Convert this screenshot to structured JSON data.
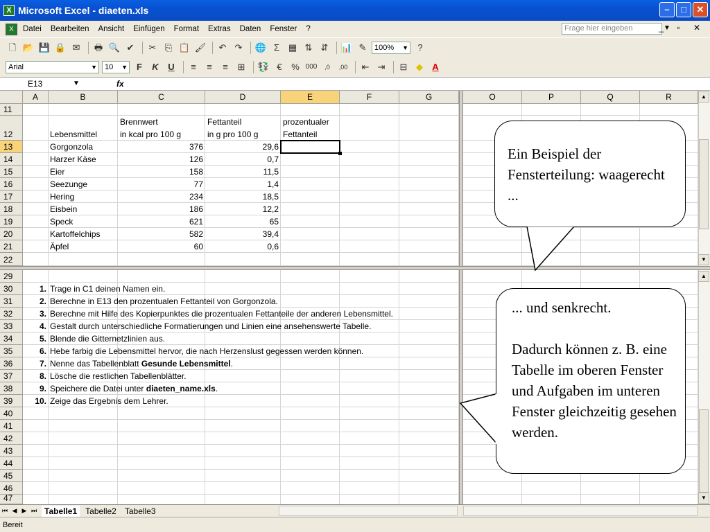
{
  "window": {
    "title": "Microsoft Excel - diaeten.xls"
  },
  "menu": {
    "items": [
      "Datei",
      "Bearbeiten",
      "Ansicht",
      "Einfügen",
      "Format",
      "Extras",
      "Daten",
      "Fenster",
      "?"
    ],
    "help_placeholder": "Frage hier eingeben"
  },
  "toolbar": {
    "zoom": "100%",
    "font": "Arial",
    "font_size": "10"
  },
  "formula_bar": {
    "name_box": "E13",
    "fx": "fx",
    "content": ""
  },
  "columns": {
    "top": [
      "A",
      "B",
      "C",
      "D",
      "E",
      "F",
      "G"
    ],
    "right": [
      "O",
      "P",
      "Q",
      "R"
    ]
  },
  "header_row": {
    "B": "Lebensmittel",
    "C1": "Brennwert",
    "C2": "in kcal pro 100 g",
    "D1": "Fettanteil",
    "D2": "in g pro 100 g",
    "E1": "prozentualer",
    "E2": "Fettanteil"
  },
  "food_rows": [
    {
      "row": "13",
      "name": "Gorgonzola",
      "kcal": "376",
      "fat": "29,6"
    },
    {
      "row": "14",
      "name": "Harzer Käse",
      "kcal": "126",
      "fat": "0,7"
    },
    {
      "row": "15",
      "name": "Eier",
      "kcal": "158",
      "fat": "11,5"
    },
    {
      "row": "16",
      "name": "Seezunge",
      "kcal": "77",
      "fat": "1,4"
    },
    {
      "row": "17",
      "name": "Hering",
      "kcal": "234",
      "fat": "18,5"
    },
    {
      "row": "18",
      "name": "Eisbein",
      "kcal": "186",
      "fat": "12,2"
    },
    {
      "row": "19",
      "name": "Speck",
      "kcal": "621",
      "fat": "65"
    },
    {
      "row": "20",
      "name": "Kartoffelchips",
      "kcal": "582",
      "fat": "39,4"
    },
    {
      "row": "21",
      "name": "Äpfel",
      "kcal": "60",
      "fat": "0,6"
    }
  ],
  "top_row_numbers": [
    "11",
    "12",
    "13",
    "14",
    "15",
    "16",
    "17",
    "18",
    "19",
    "20",
    "21",
    "22"
  ],
  "bottom_row_numbers": [
    "29",
    "30",
    "31",
    "32",
    "33",
    "34",
    "35",
    "36",
    "37",
    "38",
    "39",
    "40",
    "41",
    "42",
    "43",
    "44",
    "45",
    "46",
    "47"
  ],
  "tasks": [
    {
      "num": "1.",
      "text": "Trage in C1 deinen Namen ein."
    },
    {
      "num": "2.",
      "text": "Berechne in E13 den prozentualen Fettanteil von Gorgonzola."
    },
    {
      "num": "3.",
      "text": "Berechne mit Hilfe des Kopierpunktes die prozentualen Fettanteile der anderen Lebensmittel."
    },
    {
      "num": "4.",
      "text": "Gestalt durch unterschiedliche Formatierungen und Linien eine ansehenswerte Tabelle."
    },
    {
      "num": "5.",
      "text": "Blende die Gitternetzlinien aus."
    },
    {
      "num": "6.",
      "text": "Hebe farbig die Lebensmittel hervor, die nach Herzenslust gegessen werden können."
    },
    {
      "num": "7.",
      "text": "Nenne das Tabellenblatt ",
      "bold": "Gesunde Lebensmittel",
      "after": "."
    },
    {
      "num": "8.",
      "text": "Lösche die restlichen Tabellenblätter."
    },
    {
      "num": "9.",
      "text": "Speichere die Datei unter ",
      "bold": "diaeten_name.xls",
      "after": "."
    },
    {
      "num": "10.",
      "text": " Zeige das Ergebnis dem Lehrer."
    }
  ],
  "sheet_tabs": [
    "Tabelle1",
    "Tabelle2",
    "Tabelle3"
  ],
  "status": "Bereit",
  "callouts": {
    "top": "Ein Beispiel der Fensterteilung: waagerecht ...",
    "bottom_1": "... und senkrecht.",
    "bottom_2": "Dadurch können z. B. eine Tabelle im oberen Fenster und Aufgaben im unteren Fenster gleichzeitig gesehen werden."
  }
}
